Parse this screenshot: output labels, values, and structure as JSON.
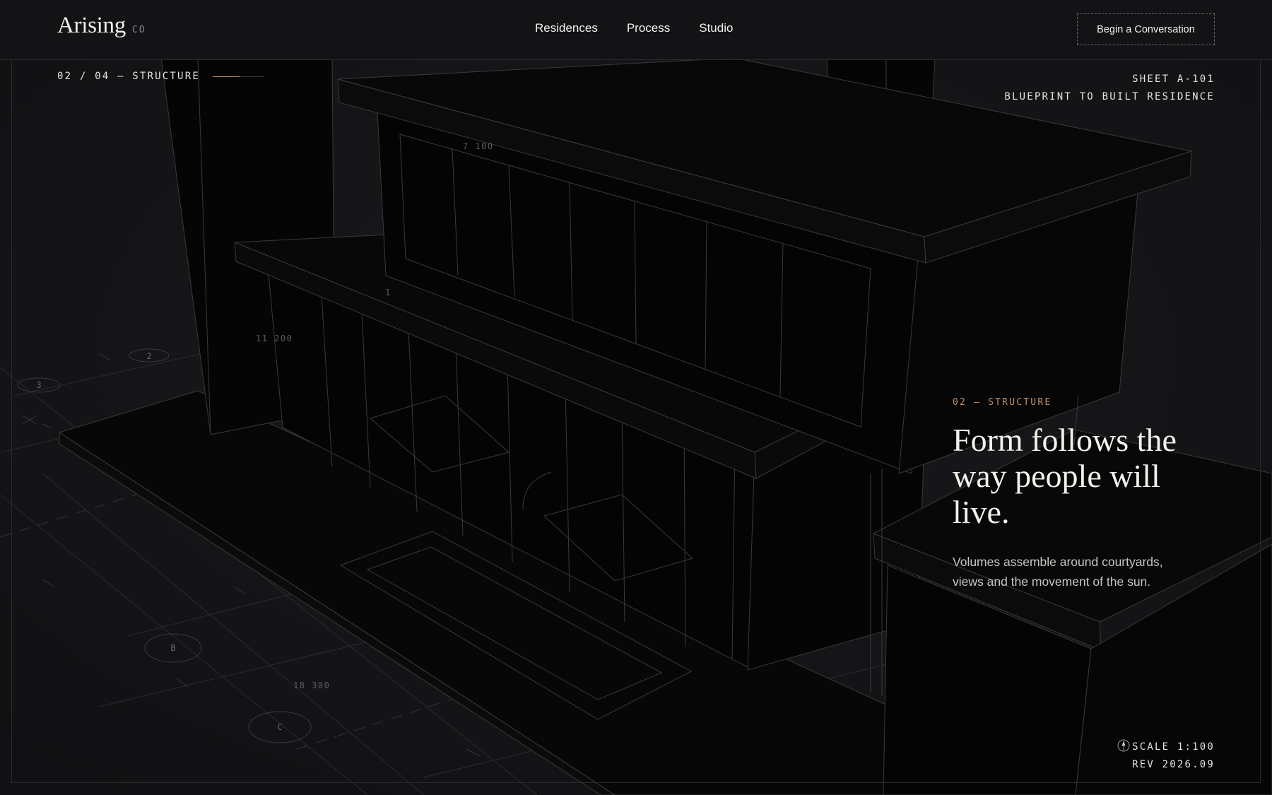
{
  "header": {
    "brand_name": "Arising",
    "brand_suffix": "CO",
    "nav": [
      {
        "label": "Residences"
      },
      {
        "label": "Process"
      },
      {
        "label": "Studio"
      }
    ],
    "cta_label": "Begin a Conversation"
  },
  "sheet": {
    "breadcrumb": "02 / 04 — STRUCTURE",
    "sheet_id": "SHEET A-101",
    "sheet_title": "BLUEPRINT TO BUILT RESIDENCE"
  },
  "drawing": {
    "dimensions": [
      "7 100",
      "11 200",
      "18 300"
    ],
    "level_label": "1",
    "grid_markers": [
      "2",
      "3",
      "B",
      "C"
    ]
  },
  "callout": {
    "eyebrow": "02 — STRUCTURE",
    "headline_line1": "Form follows the",
    "headline_line2": "way people will live.",
    "body": "Volumes assemble around courtyards, views and the movement of the sun."
  },
  "footer_meta": {
    "scale": "SCALE 1:100",
    "revision": "REV 2026.09"
  },
  "colors": {
    "background": "#141416",
    "accent": "#c0916a",
    "text": "#f4f1ea",
    "linework": "#3a3a3e"
  },
  "icons": {
    "north_arrow": "north-arrow-icon"
  }
}
